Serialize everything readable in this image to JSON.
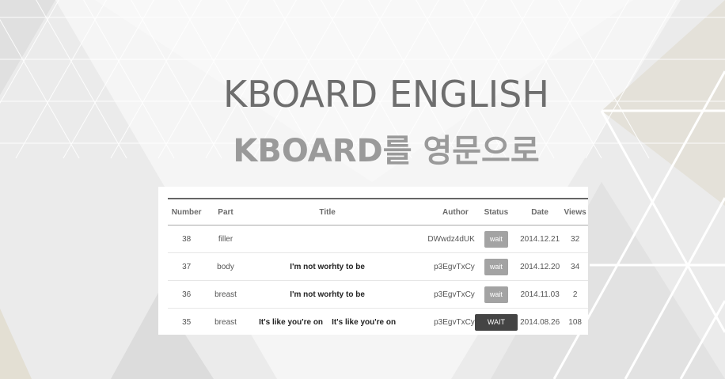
{
  "header": {
    "title": "KBOARD ENGLISH",
    "subtitle": "KBOARD를 영문으로"
  },
  "table": {
    "columns": [
      "Number",
      "Part",
      "Title",
      "Author",
      "Status",
      "Date",
      "Views"
    ],
    "rows": [
      {
        "number": "38",
        "part": "filler",
        "title": "",
        "author": "DWwdz4dUK",
        "status": "wait",
        "date": "2014.12.21",
        "views": "32"
      },
      {
        "number": "37",
        "part": "body",
        "title": "I'm not worhty to be",
        "author": "p3EgvTxCy",
        "status": "wait",
        "date": "2014.12.20",
        "views": "34"
      },
      {
        "number": "36",
        "part": "breast",
        "title": "I'm not worhty to be",
        "author": "p3EgvTxCy",
        "status": "wait",
        "date": "2014.11.03",
        "views": "2"
      },
      {
        "number": "35",
        "part": "breast",
        "title": "It's like you're on    It's like you're on",
        "author": "p3EgvTxCy",
        "status": "WAIT",
        "date": "2014.08.26",
        "views": "108"
      }
    ]
  },
  "colors": {
    "background": "#ececec",
    "title": "#6e6e6e",
    "subtitle": "#9a9a9a",
    "badge_light": "#a3a3a3",
    "badge_dark": "#444444"
  }
}
